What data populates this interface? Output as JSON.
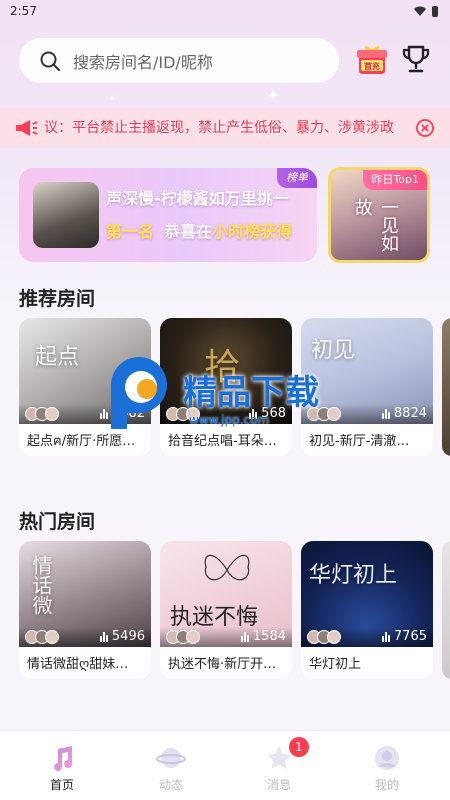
{
  "status_bar": {
    "time": "2:57"
  },
  "search": {
    "placeholder": "搜索房间名/ID/昵称"
  },
  "recharge": {
    "label": "首充"
  },
  "notice": {
    "text": "议：平台禁止主播返现，禁止产生低俗、暴力、涉黄涉政"
  },
  "banner": {
    "title": "声深慢-柠檬酱如万里挑一",
    "rank": "第一名",
    "msg_prefix": "恭喜在",
    "msg_highlight": "小时榜获得",
    "tag": "榜单"
  },
  "top1": {
    "tag": "昨日Top1",
    "art": "一见如故"
  },
  "sections": {
    "recommended": "推荐房间",
    "hot": "热门房间"
  },
  "recommended_rooms": [
    {
      "name": "起点ฅ/新厅·所愿…",
      "count": "1482",
      "art": "起点"
    },
    {
      "name": "拾音纪点唱-耳朵…",
      "count": "568",
      "art": "拾"
    },
    {
      "name": "初见-新厅-清澈…",
      "count": "8824",
      "art": "初见"
    }
  ],
  "hot_rooms": [
    {
      "name": "情话微甜ღ甜妹…",
      "count": "5496",
      "art": "情话微"
    },
    {
      "name": "执迷不悔·新厅开…",
      "count": "1584",
      "art": "执迷不悔"
    },
    {
      "name": "华灯初上",
      "count": "7765",
      "art": "华灯初上"
    }
  ],
  "watermark": {
    "title": "精品下载",
    "url": "www.jpp.com"
  },
  "tabbar": {
    "items": [
      {
        "label": "首页"
      },
      {
        "label": "动态"
      },
      {
        "label": "消息",
        "badge": "1"
      },
      {
        "label": "我的"
      }
    ]
  },
  "colors": {
    "accent": "#e23c5a",
    "notice_bg": "#fbe1e7",
    "rank_yellow": "#ffe44a"
  }
}
